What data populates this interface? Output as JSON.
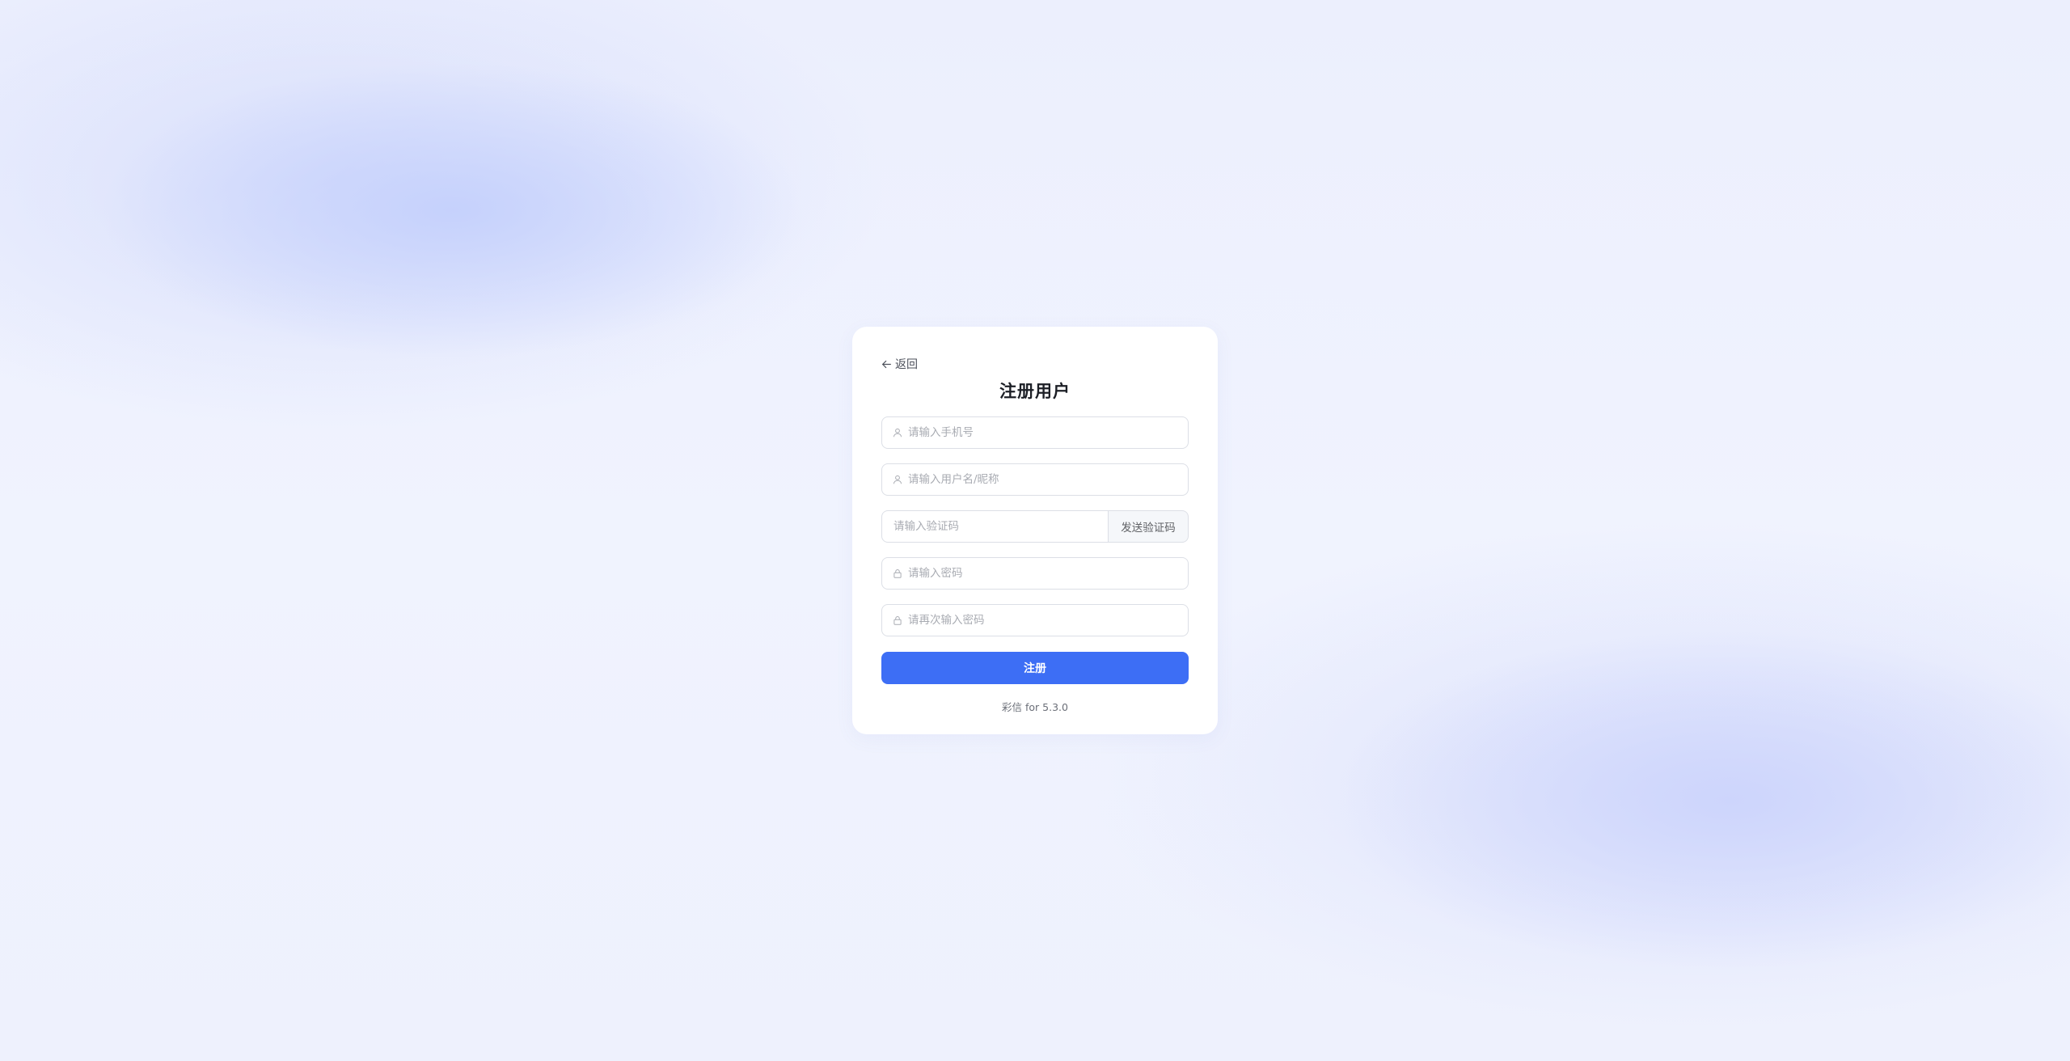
{
  "back": {
    "label": "返回"
  },
  "title": "注册用户",
  "form": {
    "phone": {
      "placeholder": "请输入手机号",
      "value": ""
    },
    "username": {
      "placeholder": "请输入用户名/昵称",
      "value": ""
    },
    "code": {
      "placeholder": "请输入验证码",
      "value": "",
      "send_label": "发送验证码"
    },
    "password": {
      "placeholder": "请输入密码",
      "value": ""
    },
    "confirm_password": {
      "placeholder": "请再次输入密码",
      "value": ""
    },
    "submit_label": "注册"
  },
  "footer": {
    "version": "彩信 for 5.3.0"
  },
  "colors": {
    "accent": "#3d6ef5",
    "background": "#eef2fd",
    "card": "#ffffff"
  },
  "icons": {
    "back": "arrow-left-icon",
    "phone": "user-icon",
    "username": "user-icon",
    "password": "lock-icon",
    "confirm_password": "lock-icon"
  }
}
